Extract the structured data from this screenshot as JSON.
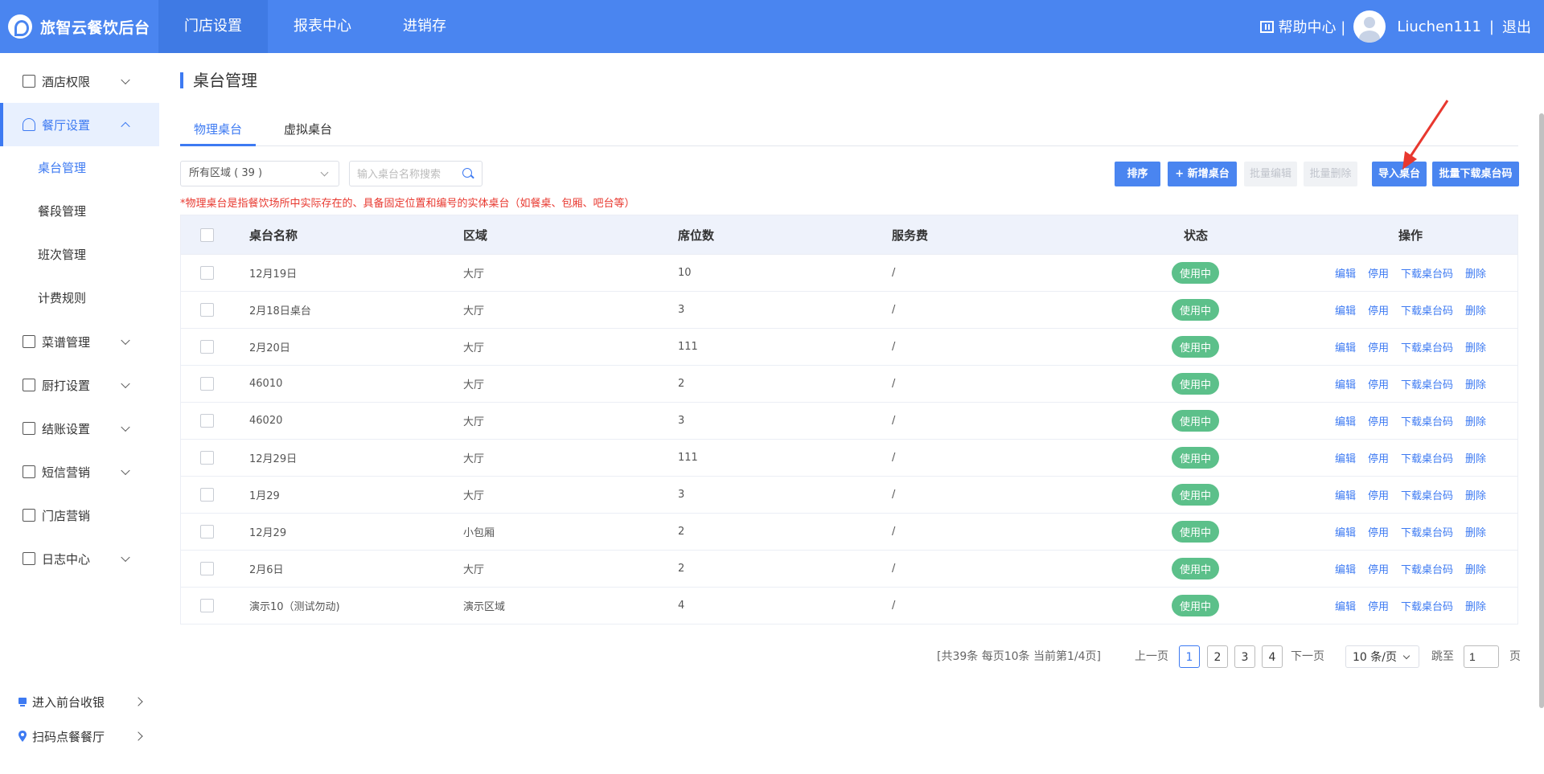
{
  "header": {
    "brand": "旅智云餐饮后台",
    "nav": [
      {
        "label": "门店设置",
        "active": true
      },
      {
        "label": "报表中心",
        "active": false
      },
      {
        "label": "进销存",
        "active": false
      }
    ],
    "help_label": "帮助中心 |",
    "username": "Liuchen111",
    "separator": "|",
    "logout_label": "退出"
  },
  "sidebar": {
    "items": [
      {
        "label": "酒店权限"
      },
      {
        "label": "餐厅设置"
      },
      {
        "label": "菜谱管理"
      },
      {
        "label": "厨打设置"
      },
      {
        "label": "结账设置"
      },
      {
        "label": "短信营销"
      },
      {
        "label": "门店营销"
      },
      {
        "label": "日志中心"
      }
    ],
    "sub_items": [
      {
        "label": "桌台管理"
      },
      {
        "label": "餐段管理"
      },
      {
        "label": "班次管理"
      },
      {
        "label": "计费规则"
      }
    ],
    "bottom_links": [
      {
        "label": "进入前台收银"
      },
      {
        "label": "扫码点餐餐厅"
      }
    ]
  },
  "page": {
    "title": "桌台管理",
    "tabs": [
      {
        "label": "物理桌台",
        "active": true
      },
      {
        "label": "虚拟桌台",
        "active": false
      }
    ],
    "area_select": "所有区域 ( 39 )",
    "search_placeholder": "输入桌台名称搜索",
    "buttons": {
      "sort": "排序",
      "add": "+ 新增桌台",
      "batch_edit": "批量编辑",
      "batch_delete": "批量删除",
      "import": "导入桌台",
      "batch_download": "批量下载桌台码"
    },
    "notice": "*物理桌台是指餐饮场所中实际存在的、具备固定位置和编号的实体桌台（如餐桌、包厢、吧台等）"
  },
  "table": {
    "columns": [
      "桌台名称",
      "区域",
      "席位数",
      "服务费",
      "状态",
      "操作"
    ],
    "actions": [
      "编辑",
      "停用",
      "下载桌台码",
      "删除"
    ],
    "rows": [
      {
        "name": "12月19日",
        "area": "大厅",
        "seats": "10",
        "fee": "/",
        "status": "使用中"
      },
      {
        "name": "2月18日桌台",
        "area": "大厅",
        "seats": "3",
        "fee": "/",
        "status": "使用中"
      },
      {
        "name": "2月20日",
        "area": "大厅",
        "seats": "111",
        "fee": "/",
        "status": "使用中"
      },
      {
        "name": "46010",
        "area": "大厅",
        "seats": "2",
        "fee": "/",
        "status": "使用中"
      },
      {
        "name": "46020",
        "area": "大厅",
        "seats": "3",
        "fee": "/",
        "status": "使用中"
      },
      {
        "name": "12月29日",
        "area": "大厅",
        "seats": "111",
        "fee": "/",
        "status": "使用中"
      },
      {
        "name": "1月29",
        "area": "大厅",
        "seats": "3",
        "fee": "/",
        "status": "使用中"
      },
      {
        "name": "12月29",
        "area": "小包厢",
        "seats": "2",
        "fee": "/",
        "status": "使用中"
      },
      {
        "name": "2月6日",
        "area": "大厅",
        "seats": "2",
        "fee": "/",
        "status": "使用中"
      },
      {
        "name": "演示10（测试勿动)",
        "area": "演示区域",
        "seats": "4",
        "fee": "/",
        "status": "使用中"
      }
    ]
  },
  "pagination": {
    "summary": "[共39条 每页10条 当前第1/4页]",
    "prev": "上一页",
    "pages": [
      "1",
      "2",
      "3",
      "4"
    ],
    "current": "1",
    "next": "下一页",
    "page_size": "10 条/页",
    "jump_label": "跳至",
    "jump_value": "1",
    "page_unit": "页"
  },
  "colors": {
    "primary": "#4a85f0",
    "status_green": "#5cc08a",
    "notice_red": "#e8382f",
    "annotation_arrow": "#e8382f"
  }
}
